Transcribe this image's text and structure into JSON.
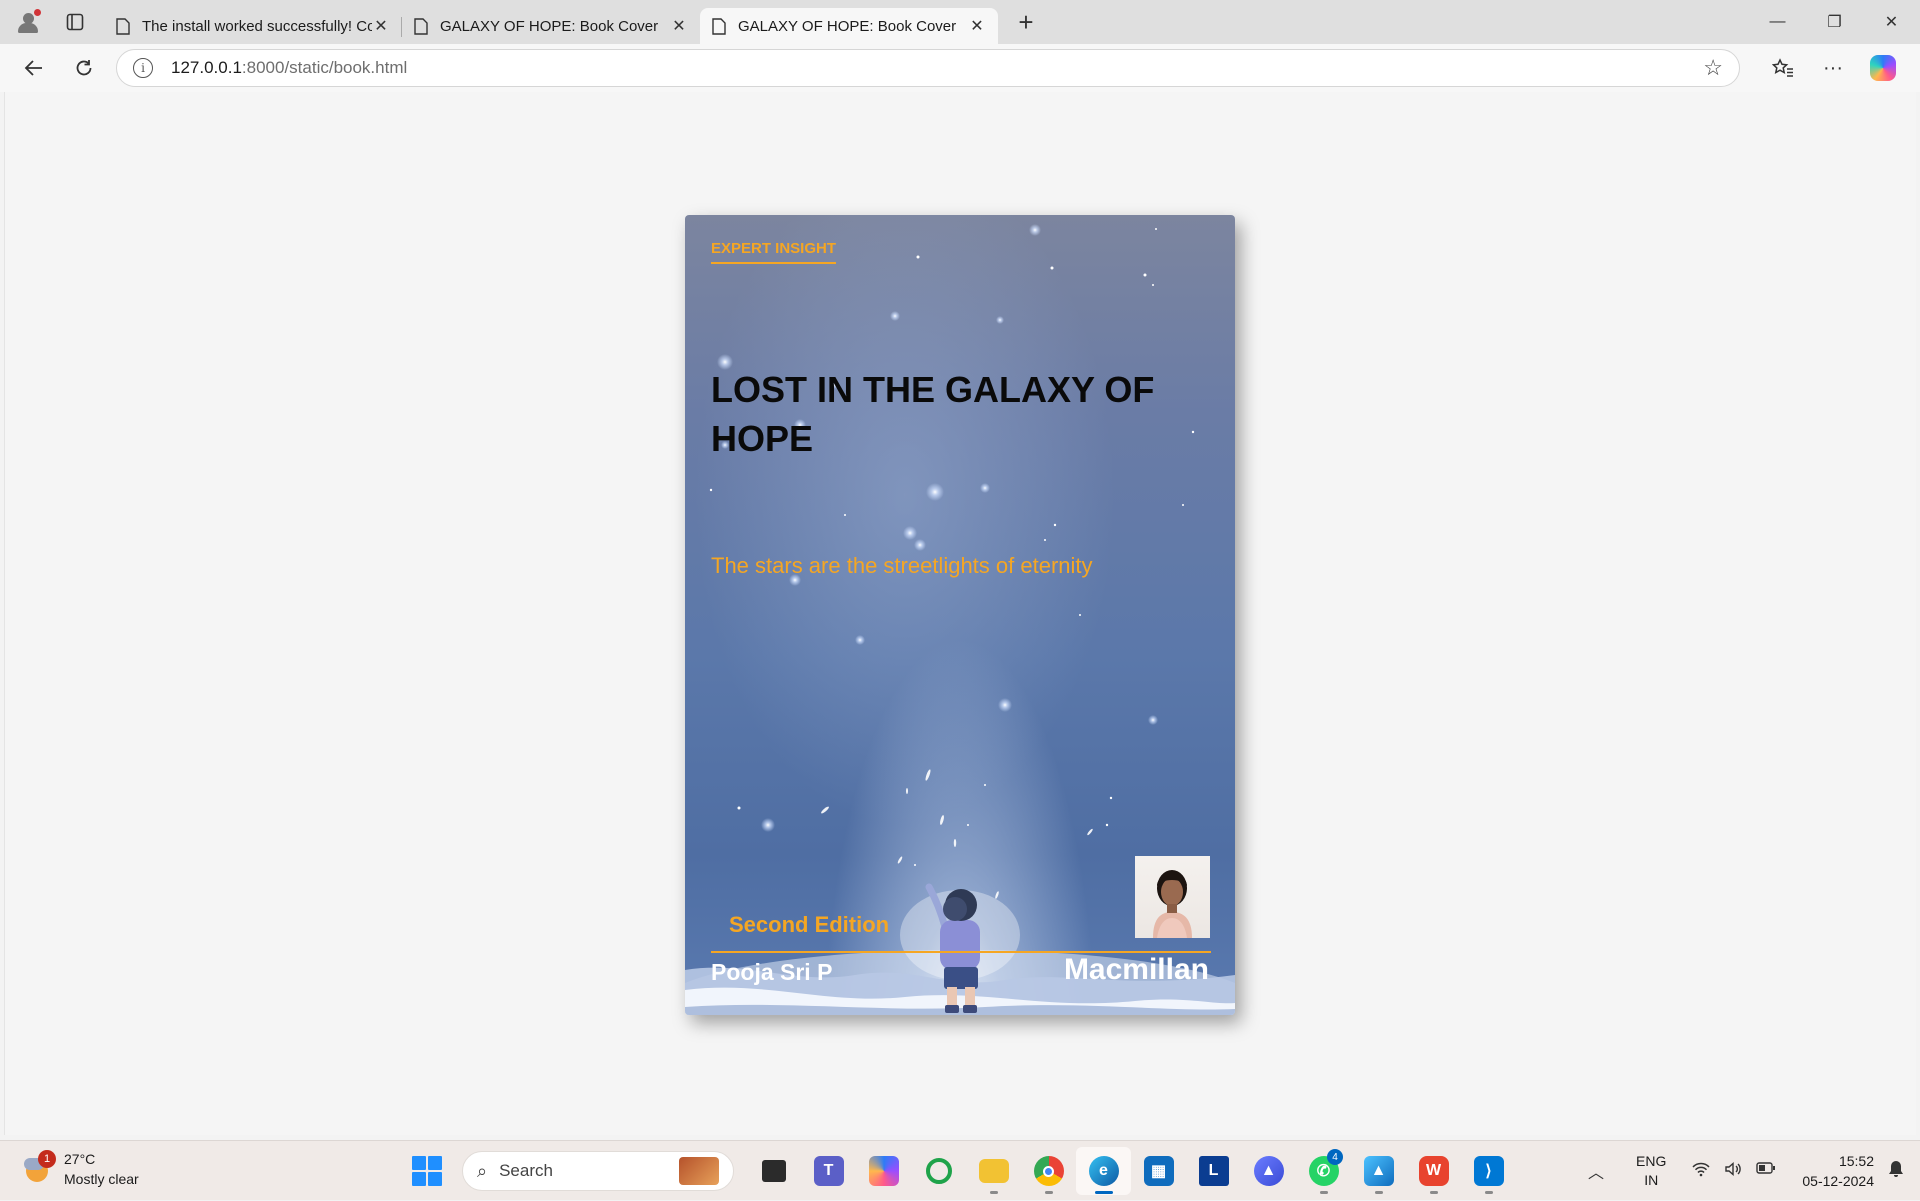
{
  "browser": {
    "tabs": [
      {
        "title": "The install worked successfully! Co",
        "active": false
      },
      {
        "title": "GALAXY OF HOPE: Book Cover",
        "active": false
      },
      {
        "title": "GALAXY OF HOPE: Book Cover",
        "active": true
      }
    ],
    "url_host": "127.0.0.1",
    "url_rest": ":8000/static/book.html"
  },
  "cover": {
    "series": "EXPERT INSIGHT",
    "title": "LOST IN THE GALAXY OF HOPE",
    "tagline": "The stars are the streetlights of eternity",
    "edition": "Second Edition",
    "author": "Pooja Sri P",
    "publisher": "Macmillan",
    "colors": {
      "accent": "#f5a623",
      "title": "#0a0a0a",
      "sky": "#5b78aa"
    }
  },
  "taskbar": {
    "weather_temp": "27°C",
    "weather_desc": "Mostly clear",
    "weather_badge": "1",
    "search_label": "Search",
    "whatsapp_badge": "4",
    "lang_line1": "ENG",
    "lang_line2": "IN",
    "time": "15:52",
    "date": "05-12-2024"
  }
}
